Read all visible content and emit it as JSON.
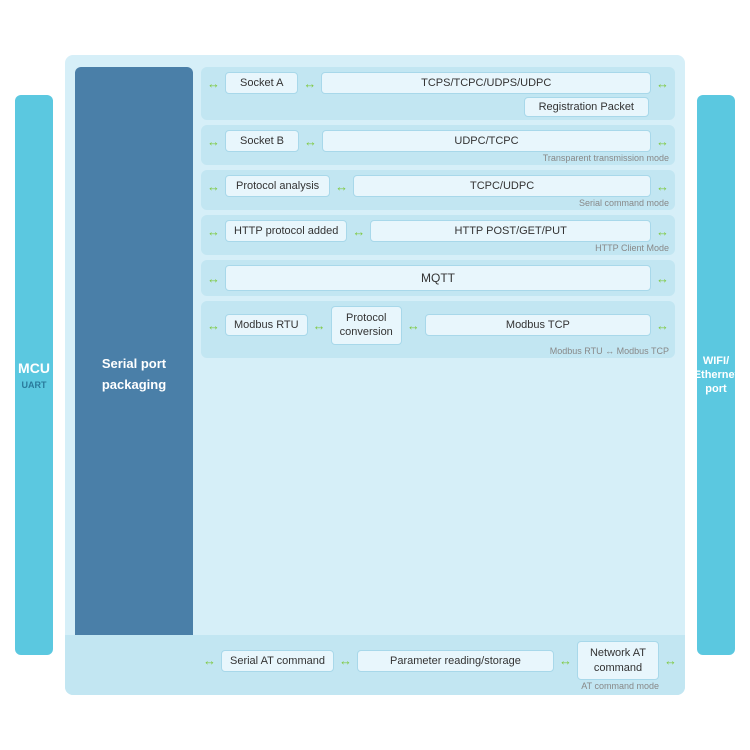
{
  "bars": {
    "mcu": "MCU",
    "uart": "UART",
    "wifi": "WIFI/\nEthernet\nport"
  },
  "serialPort": {
    "label": "Serial port\npackaging"
  },
  "rows": [
    {
      "id": "socket-a",
      "items": [
        {
          "label": "Socket A"
        },
        {
          "label": "TCPS/TCPC/UDPS/UDPC"
        }
      ],
      "subItem": "Registration Packet",
      "modeLabel": ""
    },
    {
      "id": "socket-b",
      "items": [
        {
          "label": "Socket B"
        },
        {
          "label": "UDPC/TCPC"
        }
      ],
      "subItem": null,
      "modeLabel": "Transparent transmission mode"
    },
    {
      "id": "protocol-analysis",
      "items": [
        {
          "label": "Protocol analysis"
        },
        {
          "label": "TCPC/UDPC"
        }
      ],
      "subItem": null,
      "modeLabel": "Serial command mode"
    },
    {
      "id": "http",
      "items": [
        {
          "label": "HTTP protocol added"
        },
        {
          "label": "HTTP POST/GET/PUT"
        }
      ],
      "subItem": null,
      "modeLabel": "HTTP Client Mode"
    },
    {
      "id": "mqtt",
      "items": [
        {
          "label": "MQTT"
        }
      ],
      "subItem": null,
      "modeLabel": ""
    },
    {
      "id": "modbus",
      "items": [
        {
          "label": "Modbus RTU"
        },
        {
          "label": "Protocol\nconversion"
        },
        {
          "label": "Modbus TCP"
        }
      ],
      "subItem": null,
      "modeLabel": "Modbus RTU ↔ Modbus TCP"
    }
  ],
  "atRow": {
    "items": [
      {
        "label": "Serial AT command"
      },
      {
        "label": "Parameter reading/storage"
      },
      {
        "label": "Network AT\ncommand"
      }
    ],
    "modeLabel": "AT command mode"
  },
  "arrows": {
    "double": "⟺",
    "left": "←",
    "right": "→",
    "doubleGreen": "↔"
  }
}
